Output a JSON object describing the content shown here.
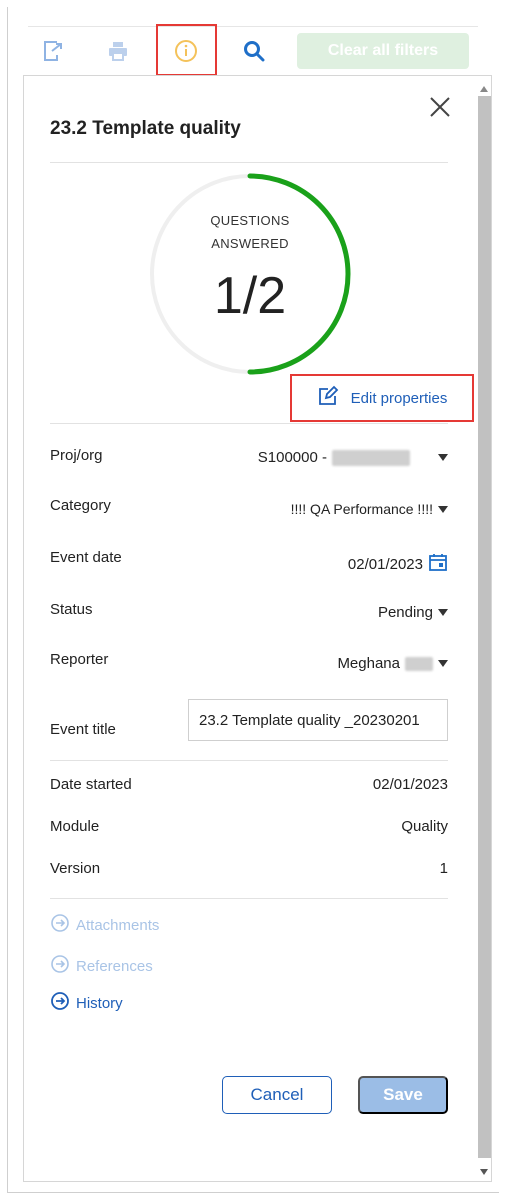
{
  "toolbar": {
    "icons": [
      "export-icon",
      "print-icon",
      "info-icon",
      "search-icon"
    ],
    "clear_filters_label": "Clear all filters"
  },
  "panel": {
    "title": "23.2 Template quality",
    "progress": {
      "label_line1": "QUESTIONS",
      "label_line2": "ANSWERED",
      "value_text": "1/2",
      "answered": 1,
      "total": 2
    },
    "edit_properties_label": "Edit properties",
    "fields": {
      "proj_org": {
        "label": "Proj/org",
        "value": "S100000 -"
      },
      "category": {
        "label": "Category",
        "value": "!!!! QA Performance !!!!"
      },
      "event_date": {
        "label": "Event date",
        "value": "02/01/2023"
      },
      "status": {
        "label": "Status",
        "value": "Pending"
      },
      "reporter": {
        "label": "Reporter",
        "value": "Meghana"
      },
      "event_title": {
        "label": "Event title",
        "value": "23.2 Template quality _20230201"
      }
    },
    "info": {
      "date_started": {
        "label": "Date started",
        "value": "02/01/2023"
      },
      "module": {
        "label": "Module",
        "value": "Quality"
      },
      "version": {
        "label": "Version",
        "value": "1"
      }
    },
    "links": {
      "attachments": "Attachments",
      "references": "References",
      "history": "History"
    },
    "buttons": {
      "cancel": "Cancel",
      "save": "Save"
    }
  },
  "colors": {
    "accent_blue": "#1f5fb8",
    "progress_green": "#1aa11a",
    "highlight_red": "#e53935",
    "info_icon_orange": "#f4b942"
  }
}
